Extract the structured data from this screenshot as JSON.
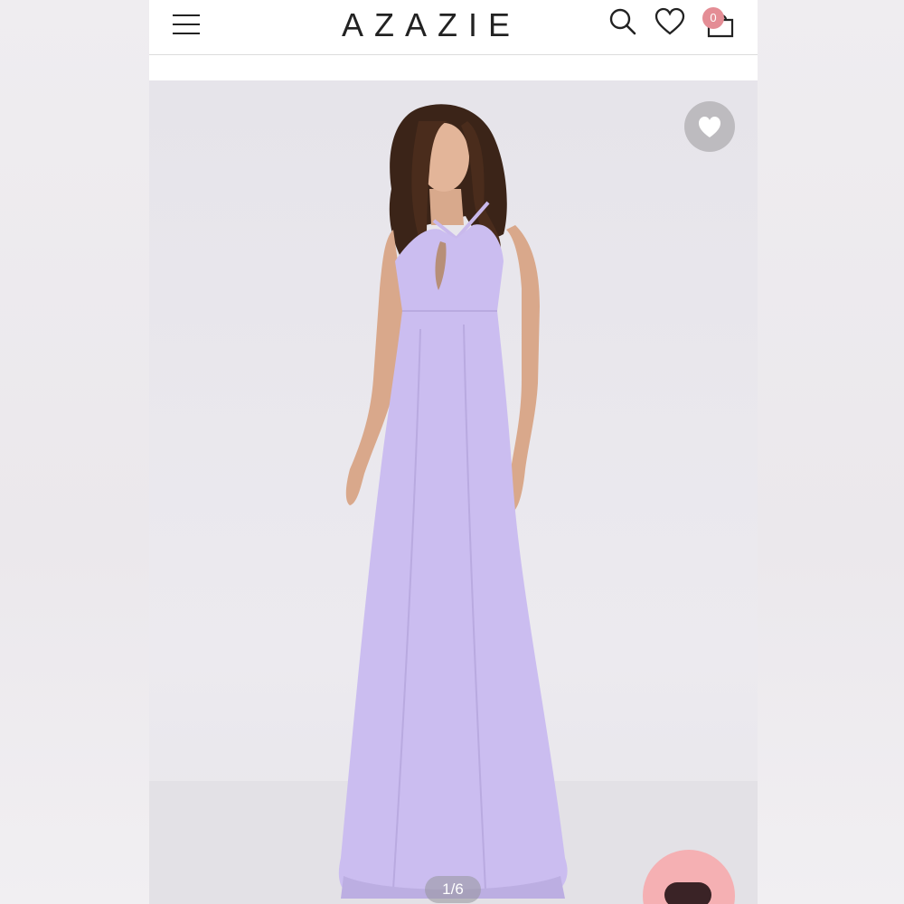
{
  "header": {
    "brand": "AZAZIE",
    "cart_count": "0"
  },
  "icons": {
    "menu": "hamburger-menu-icon",
    "search": "search-icon",
    "wishlist": "heart-outline-icon",
    "cart": "shopping-bag-icon",
    "favorite": "heart-filled-icon",
    "chat": "chat-icon"
  },
  "gallery": {
    "pager": "1/6",
    "product_color": "#cbbdf0"
  },
  "colors": {
    "badge": "#e48d95",
    "chat": "#f5b0b3",
    "dress": "#cbbdf0"
  }
}
